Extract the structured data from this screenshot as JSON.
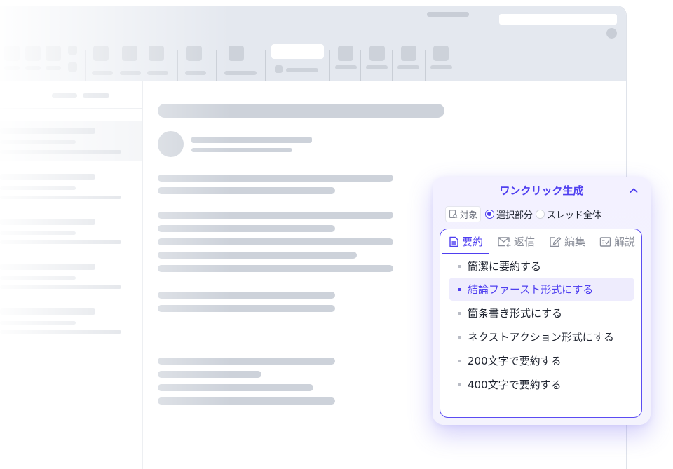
{
  "panel": {
    "title": "ワンクリック生成",
    "target_label": "対象",
    "radio_options": [
      {
        "label": "選択部分",
        "selected": true
      },
      {
        "label": "スレッド全体",
        "selected": false
      }
    ],
    "tabs": [
      {
        "label": "要約",
        "icon": "document-icon",
        "active": true
      },
      {
        "label": "返信",
        "icon": "reply-mail-icon",
        "active": false
      },
      {
        "label": "編集",
        "icon": "edit-icon",
        "active": false
      },
      {
        "label": "解説",
        "icon": "explain-icon",
        "active": false
      }
    ],
    "options": [
      {
        "label": "簡潔に要約する",
        "selected": false
      },
      {
        "label": "結論ファースト形式にする",
        "selected": true
      },
      {
        "label": "箇条書き形式にする",
        "selected": false
      },
      {
        "label": "ネクストアクション形式にする",
        "selected": false
      },
      {
        "label": "200文字で要約する",
        "selected": false
      },
      {
        "label": "400文字で要約する",
        "selected": false
      }
    ]
  },
  "colors": {
    "accent": "#4f3ff0",
    "toolbar_bg": "#e4e8ef",
    "placeholder": "#cdd2da"
  }
}
